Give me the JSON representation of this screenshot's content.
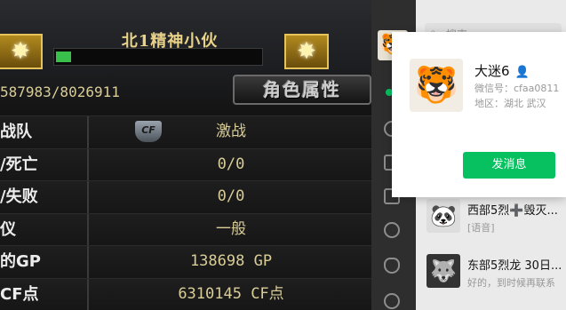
{
  "game": {
    "player_name": "北1精神小伙",
    "exp_text": "587983/8026911",
    "exp_fraction": 0.073,
    "char_attr_button": "角色属性",
    "rank_icon_glyph": "✸",
    "cf_logo_text": "CF",
    "stats": [
      {
        "label": "战队",
        "value": "激战"
      },
      {
        "label": "/死亡",
        "value": "0/0"
      },
      {
        "label": "/失败",
        "value": "0/0"
      },
      {
        "label": "仪",
        "value": "一般"
      },
      {
        "label": "的GP",
        "value": "138698 GP"
      },
      {
        "label": "CF点",
        "value": "6310145 CF点"
      }
    ]
  },
  "wechat": {
    "search_placeholder": "搜索",
    "search_icon": "search-icon",
    "card": {
      "name": "大迷6",
      "gender_icon": "👤",
      "wxid": "微信号：cfaa0811",
      "region": "地区：湖北 武汉",
      "send_button": "发消息",
      "avatar_glyph": "🐯"
    },
    "chats": [
      {
        "title": "西部5烈➕毁灭...",
        "subtitle": "[语音]",
        "avatar_glyph": "🐼"
      },
      {
        "title": "东部5烈龙 30日...",
        "subtitle": "好的，到时候再联系",
        "avatar_glyph": "🐺"
      }
    ],
    "sidebar_avatar_glyph": "🐯"
  },
  "colors": {
    "wechat_green": "#07c160",
    "game_gold": "#d9cd98"
  }
}
